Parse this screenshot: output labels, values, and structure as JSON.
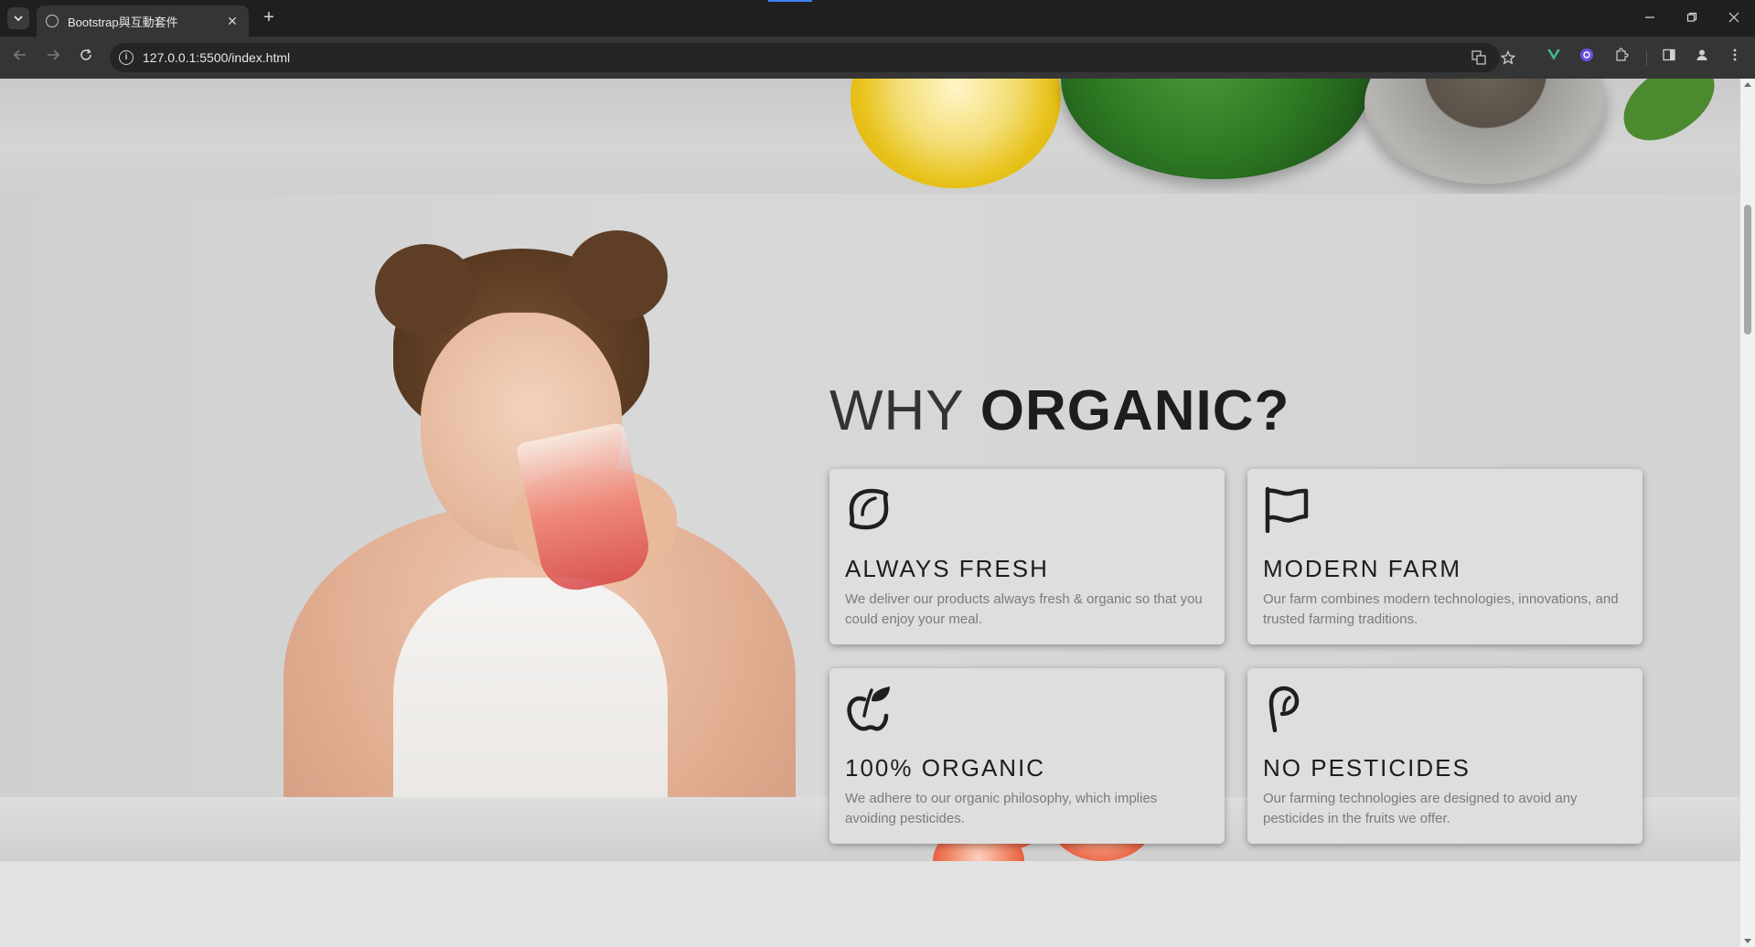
{
  "browser": {
    "tab_title": "Bootstrap與互動套件",
    "url": "127.0.0.1:5500/index.html",
    "new_tab_glyph": "+",
    "tab_close_glyph": "✕"
  },
  "section": {
    "title_light": "WHY ",
    "title_bold": "ORGANIC?"
  },
  "cards": [
    {
      "title": "ALWAYS FRESH",
      "description": "We deliver our products always fresh & organic so that you could enjoy your meal.",
      "icon": "lemon-icon"
    },
    {
      "title": "MODERN FARM",
      "description": "Our farm combines modern technologies, innovations, and trusted farming traditions.",
      "icon": "flag-icon"
    },
    {
      "title": "100% ORGANIC",
      "description": "We adhere to our organic philosophy, which implies avoiding pesticides.",
      "icon": "apple-leaf-icon"
    },
    {
      "title": "NO PESTICIDES",
      "description": "Our farming technologies are designed to avoid any pesticides in the fruits we offer.",
      "icon": "sprout-icon"
    }
  ],
  "colors": {
    "accent_blue": "#3b82f6",
    "title_dark": "#1d1d1d",
    "desc_gray": "#7b7b7b",
    "card_bg": "#dedede"
  }
}
